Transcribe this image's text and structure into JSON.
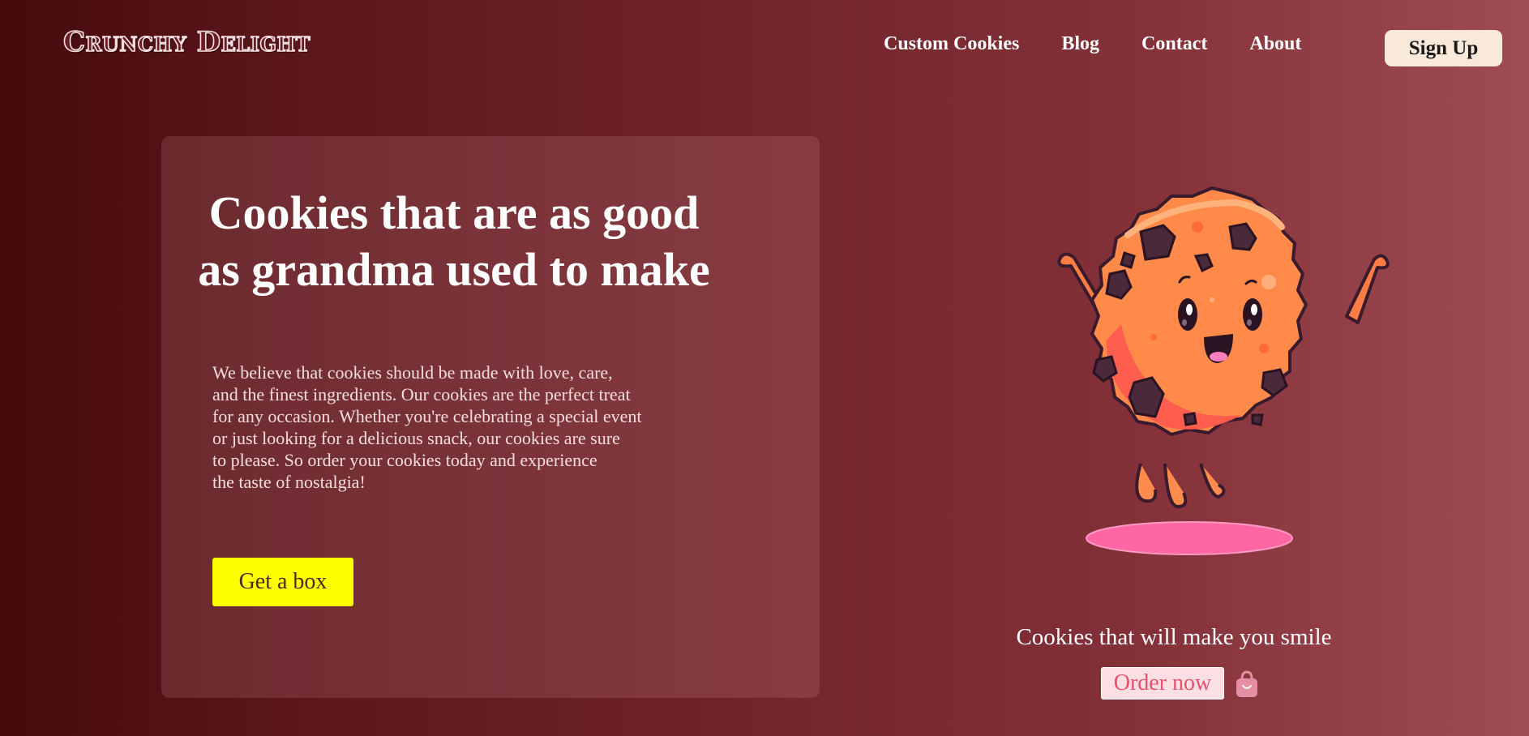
{
  "header": {
    "logo": "Crunchy Delight",
    "nav": [
      "Custom Cookies",
      "Blog",
      "Contact",
      "About"
    ],
    "signup_label": "Sign Up"
  },
  "hero": {
    "headline_line1": "Cookies that are as good",
    "headline_line2": "as grandma used to make",
    "body": "  We believe that cookies should be made with love, care,\nand the finest ingredients. Our cookies are the perfect treat\nfor any occasion. Whether you're celebrating a special event\nor just looking for a delicious snack, our cookies are sure\nto please. So order your cookies today and experience\nthe taste of nostalgia!",
    "cta_label": "Get a box"
  },
  "side": {
    "mascot_icon": "happy-cookie-illustration",
    "tagline": "Cookies that will make you smile",
    "order_label": "Order now",
    "bag_icon": "shopping-bag-icon"
  },
  "colors": {
    "cta": "#ffff00",
    "signup_bg": "#f8e9db",
    "order_text": "#e8506e",
    "order_bg": "#fbdfe3"
  }
}
